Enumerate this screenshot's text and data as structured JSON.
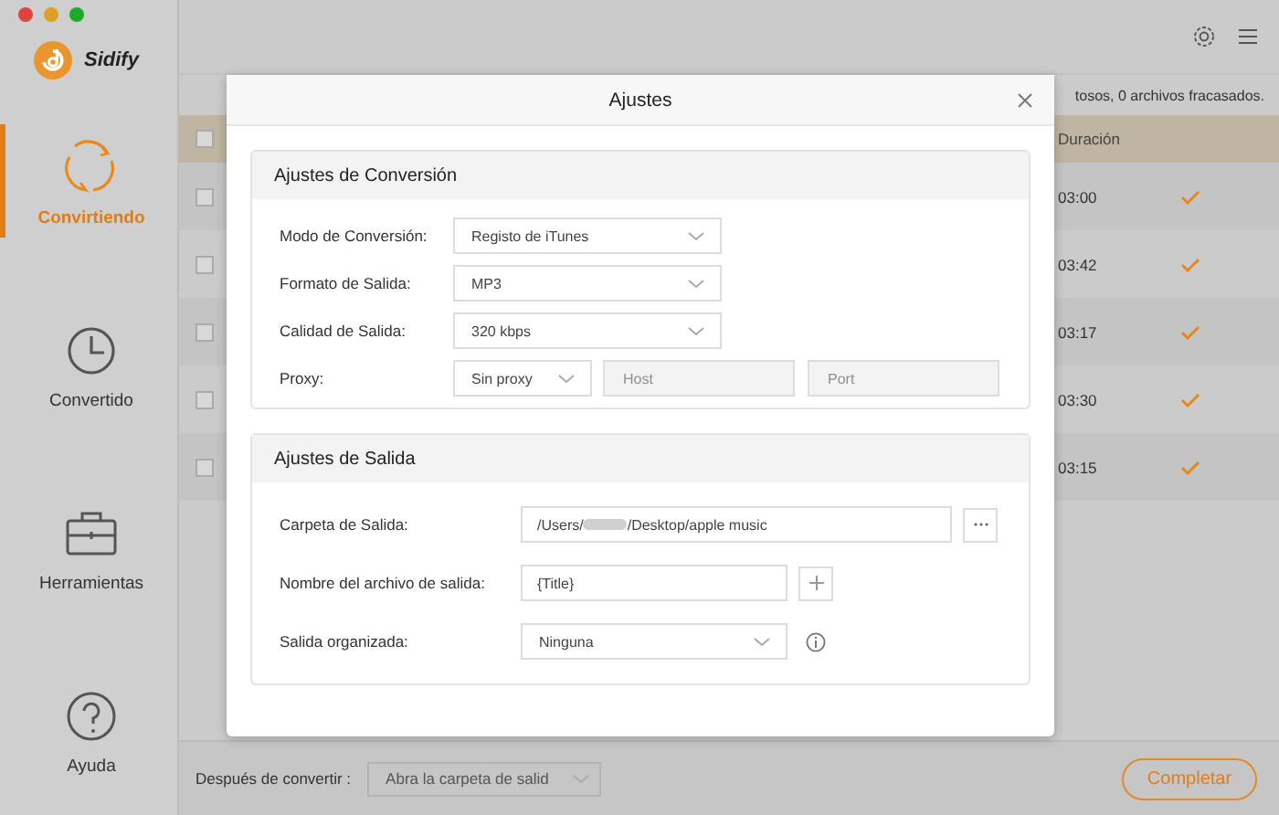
{
  "window": {
    "controls": [
      {
        "color": "#e0443e"
      },
      {
        "color": "#dea123"
      },
      {
        "color": "#1aab29"
      }
    ]
  },
  "app_name": "Sidify",
  "sidebar": {
    "items": [
      {
        "kind": "converting",
        "label": "Convirtiendo",
        "selected": true
      },
      {
        "kind": "converted",
        "label": "Convertido",
        "selected": false
      },
      {
        "kind": "tools",
        "label": "Herramientas",
        "selected": false
      },
      {
        "kind": "help",
        "label": "Ayuda",
        "selected": false
      }
    ]
  },
  "status_text": "tosos, 0 archivos fracasados.",
  "table": {
    "header_checked": false,
    "columns": [
      {
        "label": "Duración"
      }
    ],
    "rows": [
      {
        "checked": false,
        "duration": "03:00",
        "done": true
      },
      {
        "checked": false,
        "duration": "03:42",
        "done": true
      },
      {
        "checked": false,
        "duration": "03:17",
        "done": true
      },
      {
        "checked": false,
        "duration": "03:30",
        "done": true
      },
      {
        "checked": false,
        "duration": "03:15",
        "done": true
      }
    ]
  },
  "bottom_bar": {
    "label": "Después de convertir :",
    "select_value": "Abra la carpeta de salid",
    "button": "Completar"
  },
  "dialog": {
    "title": "Ajustes",
    "sections": [
      {
        "title": "Ajustes de Conversión",
        "rows": [
          {
            "kind": "select",
            "label": "Modo de Conversión:",
            "value": "Registo de iTunes"
          },
          {
            "kind": "select",
            "label": "Formato de Salida:",
            "value": "MP3"
          },
          {
            "kind": "select",
            "label": "Calidad de Salida:",
            "value": "320 kbps"
          },
          {
            "kind": "proxy",
            "label": "Proxy:",
            "value": "Sin proxy",
            "fields": [
              {
                "placeholder": "Host",
                "disabled": true
              },
              {
                "placeholder": "Port",
                "disabled": true
              }
            ]
          }
        ]
      },
      {
        "title": "Ajustes de Salida",
        "rows": [
          {
            "kind": "path",
            "label": "Carpeta de Salida:",
            "value_start": "/Users/",
            "value_end": "/Desktop/apple music"
          },
          {
            "kind": "text",
            "label": "Nombre del archivo de salida:",
            "value": "{Title}"
          },
          {
            "kind": "select_info",
            "label": "Salida organizada:",
            "value": "Ninguna"
          }
        ]
      }
    ]
  }
}
